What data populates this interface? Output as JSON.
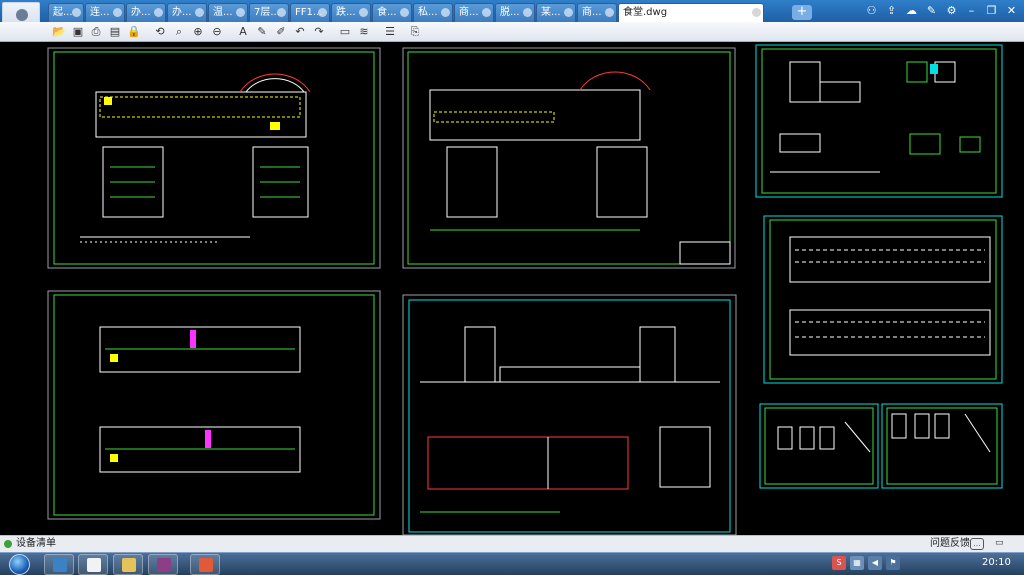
{
  "tabs": [
    {
      "label": "起..."
    },
    {
      "label": "连..."
    },
    {
      "label": "办..."
    },
    {
      "label": "办..."
    },
    {
      "label": "温..."
    },
    {
      "label": "7层..."
    },
    {
      "label": "FF1..."
    },
    {
      "label": "跌..."
    },
    {
      "label": "食..."
    },
    {
      "label": "私..."
    },
    {
      "label": "商..."
    },
    {
      "label": "脱..."
    },
    {
      "label": "某..."
    },
    {
      "label": "商..."
    },
    {
      "label": "食堂.dwg"
    }
  ],
  "new_tab_label": "+",
  "window_controls": {
    "minimize": "–",
    "maximize": "❐",
    "close": "✕"
  },
  "toolbar_icons": [
    "folder-open-icon",
    "save-icon",
    "print-icon",
    "print-preview-icon",
    "lock-icon",
    "layers-icon",
    "zoom-window-icon",
    "zoom-in-icon",
    "zoom-out-icon",
    "text-icon",
    "pen-icon",
    "measure-icon",
    "undo-icon",
    "redo-icon",
    "layer-icon",
    "hatch-icon",
    "layer-manager-icon",
    "export-icon"
  ],
  "status": {
    "text": "设备清单",
    "feedback": "问题反馈"
  },
  "taskbar": {
    "clock": "20:10"
  },
  "colors": {
    "title_bar": "#2f7fc9",
    "canvas": "#000000",
    "sheet_border": "#9aa0a6",
    "cad_green": "#3ddc3d",
    "cad_white": "#ffffff",
    "cad_yellow": "#ffff00",
    "cad_magenta": "#ff33ff",
    "cad_cyan": "#00e0e0"
  }
}
